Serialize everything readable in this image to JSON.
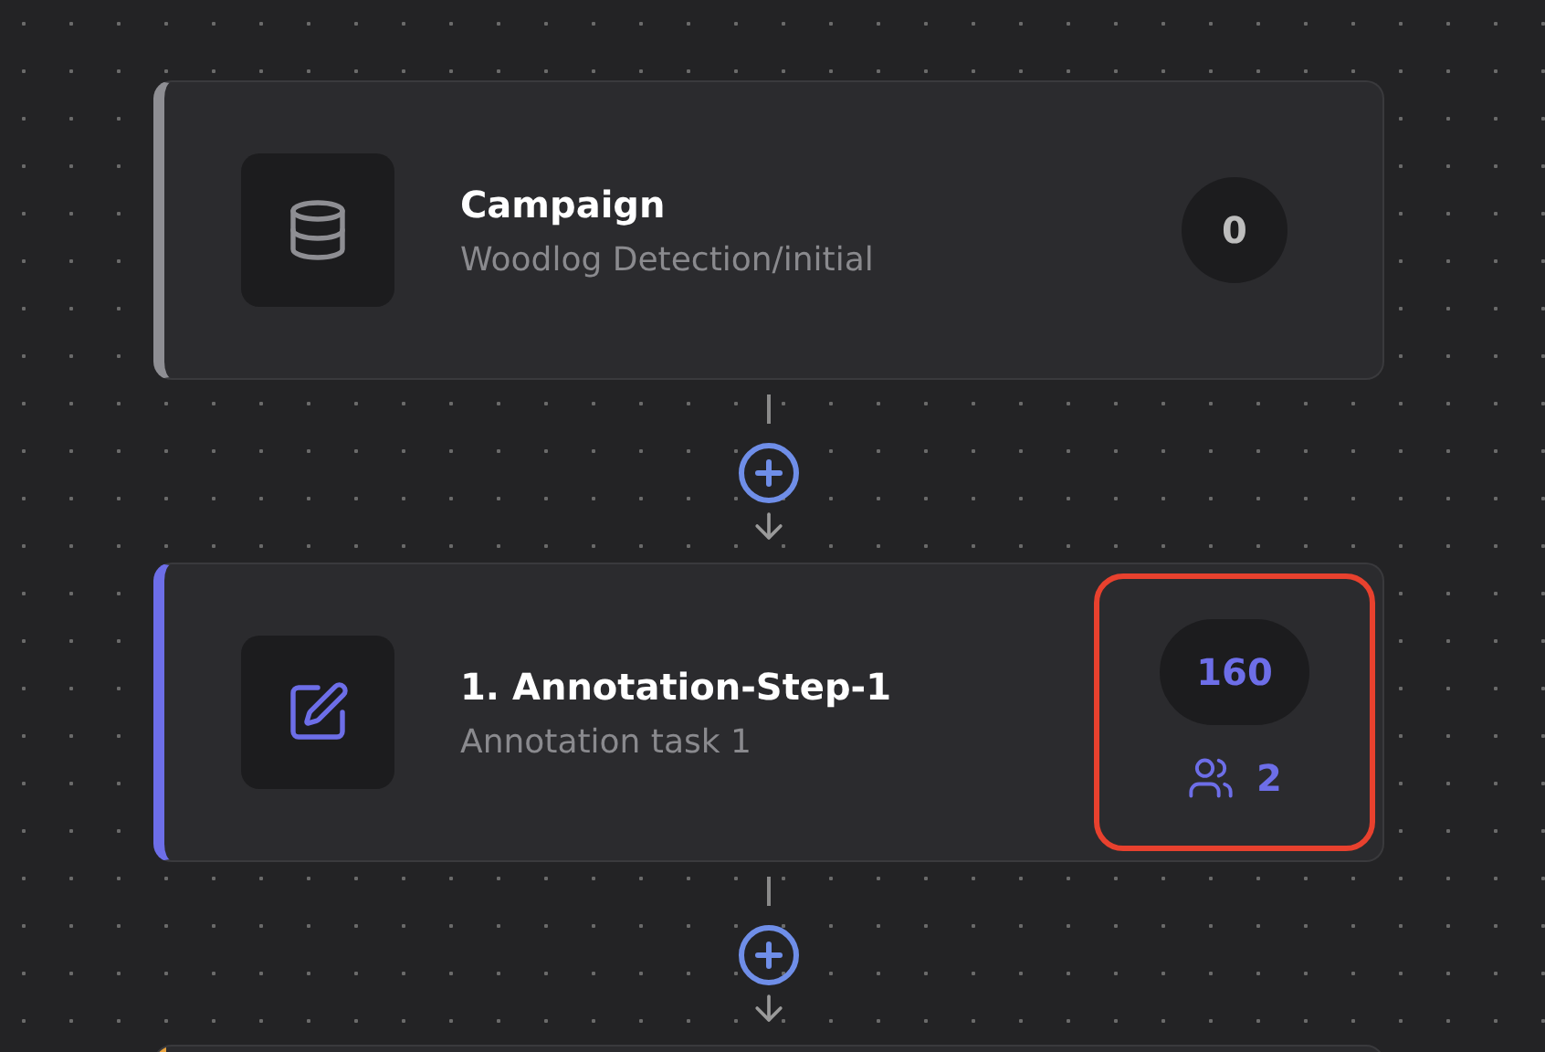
{
  "nodes": [
    {
      "kind": "campaign",
      "title": "Campaign",
      "subtitle": "Woodlog Detection/initial",
      "count": "0",
      "color": "#8e8e93",
      "highlighted": false
    },
    {
      "kind": "annotation",
      "title": "1. Annotation-Step-1",
      "subtitle": "Annotation task 1",
      "count": "160",
      "members": "2",
      "color": "#6d6ee8",
      "highlighted": true
    },
    {
      "kind": "partial",
      "color": "#e8a23c"
    }
  ]
}
